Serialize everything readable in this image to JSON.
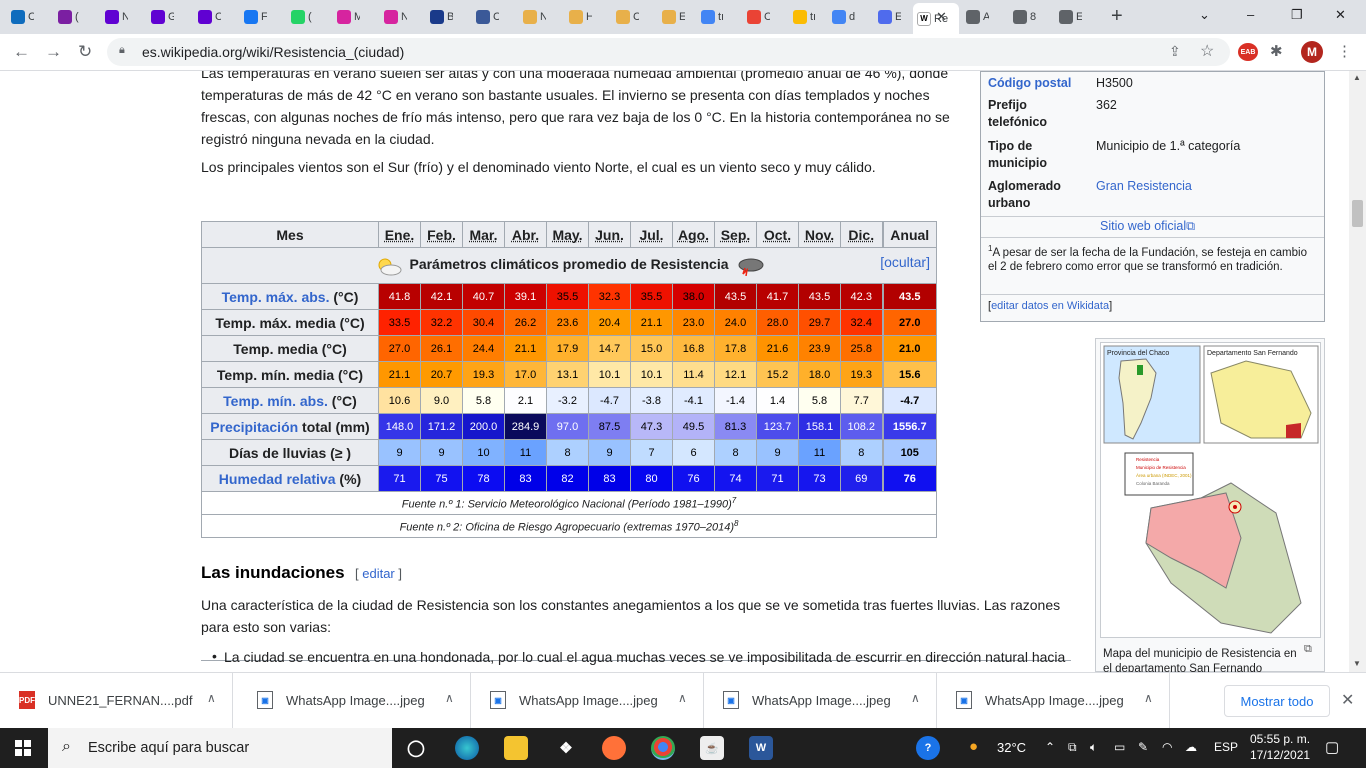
{
  "browser": {
    "tabs": [
      {
        "title": "C",
        "icon": "outlook-icon",
        "color": "#0f6cbd"
      },
      {
        "title": "(",
        "icon": "mail-icon",
        "color": "#7b1fa2"
      },
      {
        "title": "N",
        "icon": "yahoo-icon",
        "color": "#6001d2"
      },
      {
        "title": "G",
        "icon": "yahoo-icon",
        "color": "#6001d2"
      },
      {
        "title": "C",
        "icon": "yahoo-icon",
        "color": "#6001d2"
      },
      {
        "title": "F",
        "icon": "facebook-icon",
        "color": "#1877f2"
      },
      {
        "title": "(",
        "icon": "notification-icon",
        "color": "#25d366"
      },
      {
        "title": "M",
        "icon": "instagram-icon",
        "color": "#d6249f"
      },
      {
        "title": "N",
        "icon": "instagram-icon",
        "color": "#d6249f"
      },
      {
        "title": "B",
        "icon": "bp-icon",
        "color": "#1a3a8a"
      },
      {
        "title": "C",
        "icon": "site-icon",
        "color": "#3b5998"
      },
      {
        "title": "N",
        "icon": "cat-icon",
        "color": "#e8b04a"
      },
      {
        "title": "H",
        "icon": "cat-icon",
        "color": "#e8b04a"
      },
      {
        "title": "C",
        "icon": "cat-icon",
        "color": "#e8b04a"
      },
      {
        "title": "E",
        "icon": "cat-icon",
        "color": "#e8b04a"
      },
      {
        "title": "tı",
        "icon": "google-icon",
        "color": "#4285f4"
      },
      {
        "title": "C",
        "icon": "gmail-icon",
        "color": "#ea4335"
      },
      {
        "title": "tı",
        "icon": "drive-icon",
        "color": "#fbbc04"
      },
      {
        "title": "d",
        "icon": "google-icon",
        "color": "#4285f4"
      },
      {
        "title": "E",
        "icon": "lightning-icon",
        "color": "#4f6bed"
      },
      {
        "title": "Re",
        "icon": "wikipedia-icon",
        "color": "#ffffff",
        "active": true
      },
      {
        "title": "A",
        "icon": "site-icon",
        "color": "#5f6368"
      },
      {
        "title": "8",
        "icon": "site-icon",
        "color": "#5f6368"
      },
      {
        "title": "E",
        "icon": "site-icon",
        "color": "#5f6368"
      }
    ],
    "url": "es.wikipedia.org/wiki/Resistencia_(ciudad)",
    "ext_badge": "EAB",
    "avatar_letter": "M"
  },
  "article": {
    "para1_line1": "Las temperaturas en verano suelen ser altas y con una moderada humedad ambiental (promedio anual de 46 %), donde",
    "para1_line2": "temperaturas de más de 42 °C en verano son bastante usuales. El invierno se presenta con días templados y noches",
    "para1_line3": "frescas, con algunas noches de frío más intenso, pero que rara vez baja de los 0 °C. En la historia contemporánea no se",
    "para1_line4": "registró ninguna nevada en la ciudad.",
    "para2": "Los principales vientos son el Sur (frío) y el denominado viento Norte, el cual es un viento seco y muy cálido.",
    "section_title": "Las inundaciones",
    "edit_open": "[ ",
    "edit_label": "editar",
    "edit_close": " ]",
    "para3_line1": "Una característica de la ciudad de Resistencia son los constantes anegamientos a los que se ve sometida tras fuertes lluvias. Las razones",
    "para3_line2": "para esto son varias:",
    "bullet1": "La ciudad se encuentra en una hondonada, por lo cual el agua muchas veces se ve imposibilitada de escurrir en dirección natural hacia"
  },
  "climate_table": {
    "title": "Parámetros climáticos promedio de Resistencia",
    "hide_label": "[ocultar]",
    "header_month": "Mes",
    "months": [
      "Ene.",
      "Feb.",
      "Mar.",
      "Abr.",
      "May.",
      "Jun.",
      "Jul.",
      "Ago.",
      "Sep.",
      "Oct.",
      "Nov.",
      "Dic."
    ],
    "header_annual": "Anual",
    "rows": [
      {
        "label": "Temp. máx. abs. (°C)",
        "link": "Temp. máx. abs.",
        "rest": " (°C)",
        "values": [
          "41.8",
          "42.1",
          "40.7",
          "39.1",
          "35.5",
          "32.3",
          "35.5",
          "38.0",
          "43.5",
          "41.7",
          "43.5",
          "42.3"
        ],
        "annual": "43.5",
        "colors": [
          "#b80000",
          "#b80000",
          "#c20000",
          "#cc0000",
          "#ee1100",
          "#ff3300",
          "#ee1100",
          "#d50000",
          "#b20000",
          "#b80000",
          "#b20000",
          "#b80000"
        ],
        "annual_color": "#b20000",
        "text": [
          "#fff",
          "#fff",
          "#fff",
          "#fff",
          "#000",
          "#000",
          "#000",
          "#000",
          "#fff",
          "#fff",
          "#fff",
          "#fff"
        ],
        "annual_text": "#fff"
      },
      {
        "label": "Temp. máx. media (°C)",
        "values": [
          "33.5",
          "32.2",
          "30.4",
          "26.2",
          "23.6",
          "20.4",
          "21.1",
          "23.0",
          "24.0",
          "28.0",
          "29.7",
          "32.4"
        ],
        "annual": "27.0",
        "colors": [
          "#ff2200",
          "#ff3300",
          "#ff4a00",
          "#ff6b00",
          "#ff8400",
          "#ff9c00",
          "#ff9700",
          "#ff8800",
          "#ff8100",
          "#ff5f00",
          "#ff5000",
          "#ff3300"
        ],
        "annual_color": "#ff6500",
        "text": [
          "#000",
          "#000",
          "#000",
          "#000",
          "#000",
          "#000",
          "#000",
          "#000",
          "#000",
          "#000",
          "#000",
          "#000"
        ],
        "annual_text": "#000"
      },
      {
        "label": "Temp. media (°C)",
        "values": [
          "27.0",
          "26.1",
          "24.4",
          "21.1",
          "17.9",
          "14.7",
          "15.0",
          "16.8",
          "17.8",
          "21.6",
          "23.9",
          "25.8"
        ],
        "annual": "21.0",
        "colors": [
          "#ff6500",
          "#ff6e00",
          "#ff7d00",
          "#ff9700",
          "#ffb12c",
          "#ffc85a",
          "#ffc656",
          "#ffba40",
          "#ffb12e",
          "#ff9300",
          "#ff8200",
          "#ff7000"
        ],
        "annual_color": "#ff9800",
        "text": [
          "#000",
          "#000",
          "#000",
          "#000",
          "#000",
          "#000",
          "#000",
          "#000",
          "#000",
          "#000",
          "#000",
          "#000"
        ],
        "annual_text": "#000"
      },
      {
        "label": "Temp. mín. media (°C)",
        "values": [
          "21.1",
          "20.7",
          "19.3",
          "17.0",
          "13.1",
          "10.1",
          "10.1",
          "11.4",
          "12.1",
          "15.2",
          "18.0",
          "19.3"
        ],
        "annual": "15.6",
        "colors": [
          "#ff9700",
          "#ff9a00",
          "#ffa416",
          "#ffb638",
          "#ffd271",
          "#ffe8a6",
          "#ffe8a6",
          "#ffde8e",
          "#ffda82",
          "#ffc452",
          "#ffb02a",
          "#ffa416"
        ],
        "annual_color": "#ffc04a",
        "text": [
          "#000",
          "#000",
          "#000",
          "#000",
          "#000",
          "#000",
          "#000",
          "#000",
          "#000",
          "#000",
          "#000",
          "#000"
        ],
        "annual_text": "#000"
      },
      {
        "label": "Temp. mín. abs. (°C)",
        "link": "Temp. mín. abs.",
        "rest": " (°C)",
        "values": [
          "10.6",
          "9.0",
          "5.8",
          "2.1",
          "-3.2",
          "-4.7",
          "-3.8",
          "-4.1",
          "-1.4",
          "1.4",
          "5.8",
          "7.7"
        ],
        "annual": "-4.7",
        "colors": [
          "#ffe2a0",
          "#fff0c0",
          "#fffff0",
          "#fdfdff",
          "#e8f0ff",
          "#dce8ff",
          "#e3edff",
          "#e0ebff",
          "#f3f6ff",
          "#fefeff",
          "#fffff0",
          "#fff7d8"
        ],
        "annual_color": "#dce8ff",
        "text": [
          "#000",
          "#000",
          "#000",
          "#000",
          "#000",
          "#000",
          "#000",
          "#000",
          "#000",
          "#000",
          "#000",
          "#000"
        ],
        "annual_text": "#000"
      },
      {
        "label": "Precipitación total (mm)",
        "link": "Precipitación",
        "rest": " total (mm)",
        "values": [
          "148.0",
          "171.2",
          "200.0",
          "284.9",
          "97.0",
          "87.5",
          "47.3",
          "49.5",
          "81.3",
          "123.7",
          "158.1",
          "108.2"
        ],
        "annual": "1556.7",
        "colors": [
          "#3535e8",
          "#2626dc",
          "#1616cc",
          "#0a0a5c",
          "#6f6ff0",
          "#7e7ef2",
          "#b8b8f8",
          "#b3b3f8",
          "#8a8af3",
          "#4d4dec",
          "#2e2ee4",
          "#5d5dee"
        ],
        "annual_color": "#3a3aea",
        "text": [
          "#fff",
          "#fff",
          "#fff",
          "#fff",
          "#fff",
          "#000",
          "#000",
          "#000",
          "#000",
          "#fff",
          "#fff",
          "#fff"
        ],
        "annual_text": "#fff"
      },
      {
        "label": "Días de lluvias (≥ )",
        "values": [
          "9",
          "9",
          "10",
          "11",
          "8",
          "9",
          "7",
          "6",
          "8",
          "9",
          "11",
          "8"
        ],
        "annual": "105",
        "colors": [
          "#99c2ff",
          "#99c2ff",
          "#80b2ff",
          "#6aa2ff",
          "#add0ff",
          "#99c2ff",
          "#c0dcff",
          "#d4e7ff",
          "#add0ff",
          "#99c2ff",
          "#6aa2ff",
          "#add0ff"
        ],
        "annual_color": "#a7c8ff",
        "text": [
          "#000",
          "#000",
          "#000",
          "#000",
          "#000",
          "#000",
          "#000",
          "#000",
          "#000",
          "#000",
          "#000",
          "#000"
        ],
        "annual_text": "#000"
      },
      {
        "label": "Humedad relativa (%)",
        "link": "Humedad relativa",
        "rest": " (%)",
        "values": [
          "71",
          "75",
          "78",
          "83",
          "82",
          "83",
          "80",
          "76",
          "74",
          "71",
          "73",
          "69"
        ],
        "annual": "76",
        "colors": [
          "#1a1aee",
          "#1212f0",
          "#0c0cf2",
          "#0000e8",
          "#0000ea",
          "#0000e8",
          "#0606f0",
          "#1010f0",
          "#1414f0",
          "#1a1aee",
          "#1616ee",
          "#2020ec"
        ],
        "annual_color": "#1010f0",
        "text": [
          "#fff",
          "#fff",
          "#fff",
          "#fff",
          "#fff",
          "#fff",
          "#fff",
          "#fff",
          "#fff",
          "#fff",
          "#fff",
          "#fff"
        ],
        "annual_text": "#fff"
      }
    ],
    "source1": "Fuente n.º 1: Servicio Meteorológico Nacional (Período 1981–1990)",
    "source1_ref": "7",
    "source2": "Fuente n.º 2: Oficina de Riesgo Agropecuario (extremas 1970–2014)",
    "source2_ref": "8"
  },
  "infobox": {
    "postal_label": "Código postal",
    "postal_value": "H3500",
    "phone_label": "Prefijo telefónico",
    "phone_value": "362",
    "type_label": "Tipo de municipio",
    "type_value": "Municipio de 1.ª categoría",
    "agglo_label": "Aglomerado urbano",
    "agglo_value": "Gran Resistencia",
    "website": "Sitio web oficial",
    "note_ref": "1",
    "note": "A pesar de ser la fecha de la Fundación, se festeja en cambio el 2 de febrero como error que se transformó en tradición.",
    "wikidata_open": "[",
    "wikidata": "editar datos en Wikidata",
    "wikidata_close": "]"
  },
  "thumbnail": {
    "map_label_left": "Provincia del Chaco",
    "map_label_right": "Departamento San Fernando",
    "legend": [
      "Resistencia",
      "Municipio de Resistencia",
      "Área urbana (INDEC, 2001)",
      "Colonia Baranda"
    ],
    "caption": "Mapa del municipio de Resistencia en el departamento San Fernando"
  },
  "downloads": {
    "items": [
      {
        "name": "UNNE21_FERNAN....pdf",
        "type": "PDF"
      },
      {
        "name": "WhatsApp Image....jpeg",
        "type": "img"
      },
      {
        "name": "WhatsApp Image....jpeg",
        "type": "img"
      },
      {
        "name": "WhatsApp Image....jpeg",
        "type": "img"
      },
      {
        "name": "WhatsApp Image....jpeg",
        "type": "img"
      }
    ],
    "show_all": "Mostrar todo"
  },
  "taskbar": {
    "search_placeholder": "Escribe aquí para buscar",
    "temperature": "32°C",
    "language": "ESP",
    "time": "05:55 p. m.",
    "date": "17/12/2021"
  }
}
